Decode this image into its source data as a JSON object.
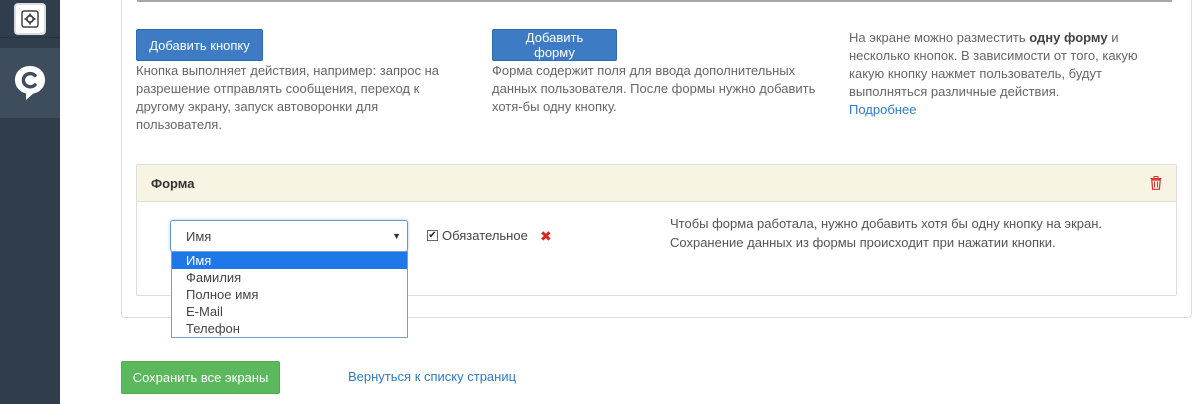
{
  "sidebar": {
    "items": [
      {
        "icon": "settings-icon"
      },
      {
        "icon": "chat-logo-icon"
      }
    ]
  },
  "buttons_section": {
    "add_button": {
      "label": "Добавить кнопку",
      "description": "Кнопка выполняет действия, например: запрос на разрешение отправлять сообщения, переход к другому экрану, запуск автоворонки для пользователя."
    },
    "add_form": {
      "label": "Добавить форму",
      "description": "Форма содержит поля для ввода дополнительных данных пользователя. После формы нужно добавить хотя-бы одну кнопку."
    },
    "info": {
      "text_before_bold": "На экране можно разместить",
      "bold_text": "одну форму",
      "text_after_bold": "и несколько кнопок. В зависимости от того, какую какую кнопку нажмет пользователь, будут выполняться различные действия.",
      "more_link": "Подробнее"
    }
  },
  "form_block": {
    "title": "Форма",
    "delete_icon": "trash-icon",
    "field_select": {
      "value": "Имя",
      "options": [
        "Имя",
        "Фамилия",
        "Полное имя",
        "E-Mail",
        "Телефон"
      ],
      "selected_index": 0
    },
    "required_label": "Обязательное",
    "required_checked": true,
    "remove_icon": "close-icon",
    "hint": "Чтобы форма работала, нужно добавить хотя бы одну кнопку на экран. Сохранение данных из формы происходит при нажатии кнопки."
  },
  "footer": {
    "save_button": "Сохранить все экраны",
    "back_link": "Вернуться к списку страниц"
  },
  "colors": {
    "sidebar_bg": "#2f3d4c",
    "primary_button": "#3d7cc4",
    "success_button": "#5cb85c",
    "link": "#2e7bc4",
    "form_header_bg": "#f7f4e4",
    "danger": "#e0221f"
  }
}
